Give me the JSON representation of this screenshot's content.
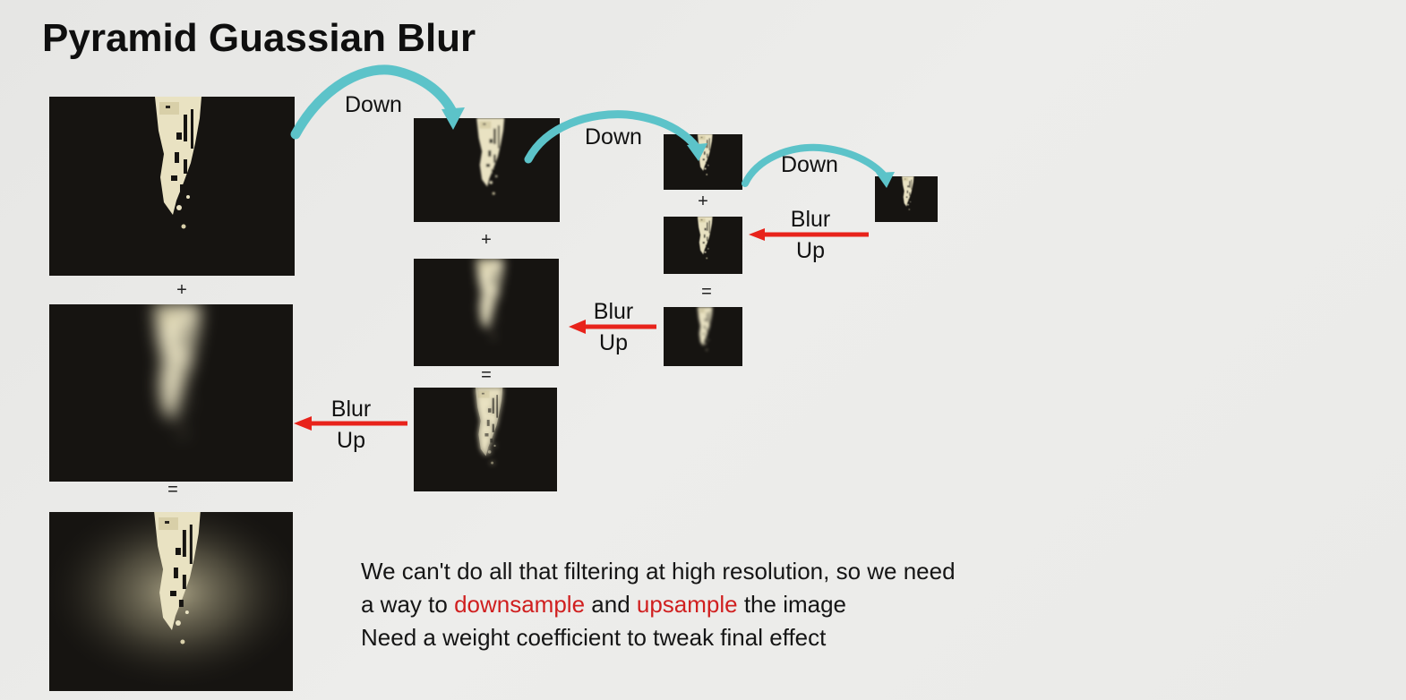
{
  "slide": {
    "title": "Pyramid Guassian Blur"
  },
  "labels": {
    "down": "Down",
    "blur": "Blur",
    "up": "Up",
    "plus": "+",
    "equals": "="
  },
  "colors": {
    "down_arrow": "#5cc3c9",
    "blur_up_arrow": "#e8231b",
    "highlight_text": "#d01f1f",
    "image_background": "#161411",
    "image_highlight": "#e9e2c2"
  },
  "notes": {
    "line1": "We can't do all that filtering at high resolution, so we need",
    "line2_a": "a way to ",
    "line2_downsample": "downsample",
    "line2_and": " and ",
    "line2_upsample": "upsample",
    "line2_b": " the image",
    "line3": "Need a weight coefficient to tweak final effect"
  }
}
